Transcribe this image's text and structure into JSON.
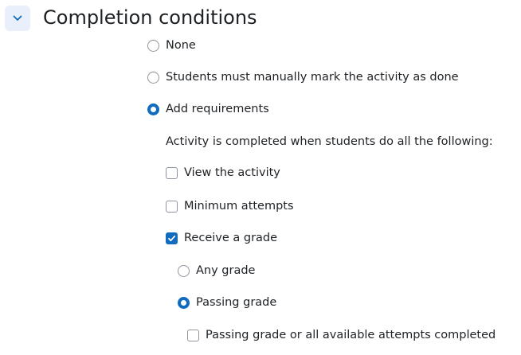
{
  "section": {
    "title": "Completion conditions",
    "collapse_icon": "chevron-down-icon",
    "accent": "#0f6cbf"
  },
  "completion": {
    "options": [
      {
        "label": "None",
        "selected": false
      },
      {
        "label": "Students must manually mark the activity as done",
        "selected": false
      },
      {
        "label": "Add requirements",
        "selected": true
      }
    ],
    "requirements_intro": "Activity is completed when students do all the following:",
    "requirements": {
      "view": {
        "label": "View the activity",
        "checked": false
      },
      "min_attempts": {
        "label": "Minimum attempts",
        "checked": false
      },
      "receive_grade": {
        "label": "Receive a grade",
        "checked": true
      }
    },
    "grade_options": [
      {
        "label": "Any grade",
        "selected": false
      },
      {
        "label": "Passing grade",
        "selected": true
      }
    ],
    "passing_or_attempts": {
      "label": "Passing grade or all available attempts completed",
      "checked": false
    }
  }
}
